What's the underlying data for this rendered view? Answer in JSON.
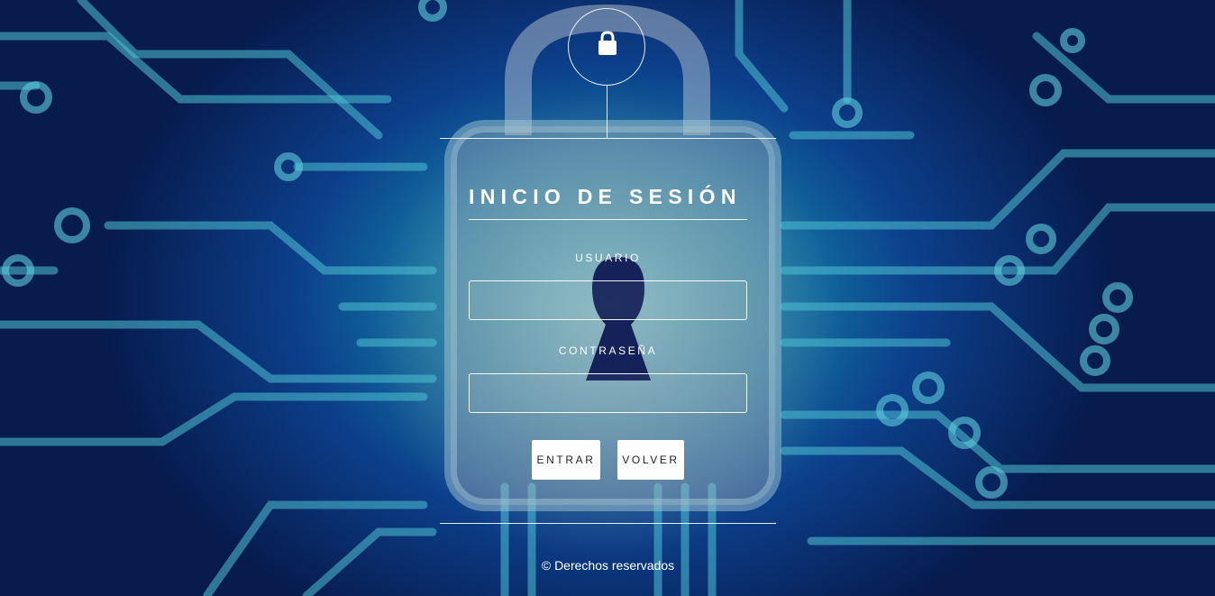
{
  "header": {
    "icon": "lock-icon"
  },
  "form": {
    "title": "INICIO DE SESIÓN",
    "username_label": "USUARIO",
    "username_value": "",
    "password_label": "CONTRASEÑA",
    "password_value": "",
    "submit_label": "ENTRAR",
    "back_label": "VOLVER"
  },
  "footer": {
    "text": "© Derechos reservados"
  },
  "colors": {
    "background_dark": "#071b4d",
    "background_mid": "#0c3f8a",
    "circuit_cyan": "#1fb0c4",
    "button_bg": "#ffffff",
    "button_text": "#222222"
  }
}
